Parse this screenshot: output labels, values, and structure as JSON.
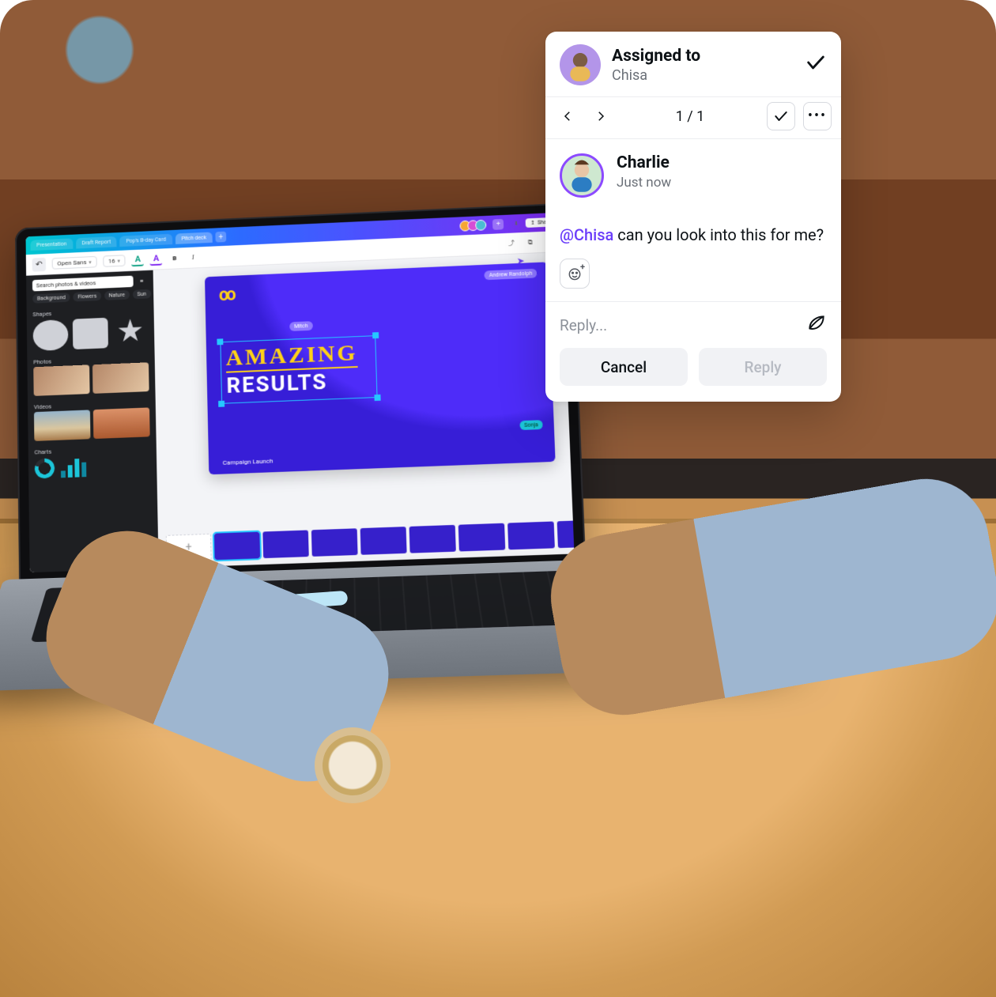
{
  "tabs": {
    "items": [
      "Presentation",
      "Draft Report",
      "Pop's B-day Card",
      "Pitch deck"
    ],
    "active_index": 3,
    "share_label": "Share"
  },
  "toolbar": {
    "font_family": "Open Sans",
    "font_size": "16",
    "bold_glyph": "B",
    "italic_glyph": "I",
    "a1_glyph": "A",
    "a2_glyph": "A"
  },
  "sidebar": {
    "search_placeholder": "Search photos & videos",
    "chips": [
      "Background",
      "Flowers",
      "Nature",
      "Sun"
    ],
    "sections": {
      "shapes": "Shapes",
      "photos": "Photos",
      "videos": "Videos",
      "charts": "Charts"
    }
  },
  "slide": {
    "logo": "OO",
    "pill_top": "Mitch",
    "pill_right": "Andrew Randolph",
    "pill_br": "Sonja",
    "headline_1": "AMAZING",
    "headline_2": "RESULTS",
    "footer": "Campaign Launch",
    "thumb_count": 8
  },
  "popover": {
    "assigned_label": "Assigned to",
    "assignee": "Chisa",
    "counter": "1 / 1",
    "commenter": "Charlie",
    "timestamp": "Just now",
    "mention": "@Chisa",
    "comment_rest": " can you look into this for me?",
    "reply_placeholder": "Reply...",
    "cancel_label": "Cancel",
    "reply_label": "Reply"
  }
}
